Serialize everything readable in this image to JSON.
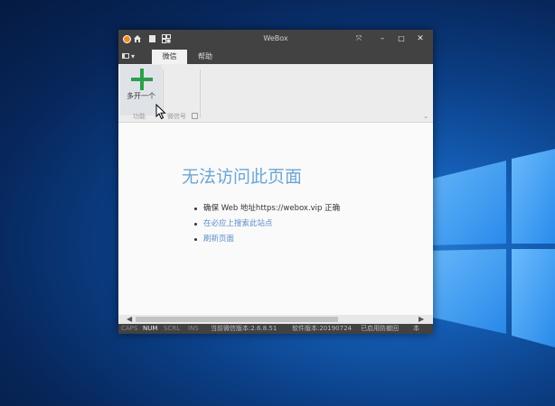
{
  "window": {
    "title": "WeBox",
    "controls": {
      "fullscreen": "⤧",
      "minimize": "–",
      "maximize": "□",
      "close": "✕"
    }
  },
  "tabs": {
    "menu": "▾",
    "items": [
      {
        "label": "微信",
        "active": true
      },
      {
        "label": "帮助",
        "active": false
      }
    ]
  },
  "ribbon": {
    "open_one_label": "多开一个",
    "group_function": "功能",
    "group_wechat": "微信号"
  },
  "content": {
    "error_title": "无法访问此页面",
    "items": [
      {
        "text": "确保 Web 地址https://webox.vip 正确",
        "link": false
      },
      {
        "text": "在必应上搜索此站点",
        "link": true
      },
      {
        "text": "刷新页面",
        "link": true
      }
    ]
  },
  "scrollbar": {
    "left_arrow": "◀",
    "right_arrow": "▶"
  },
  "statusbar": {
    "caps": "CAPS",
    "num": "NUM",
    "scrl": "SCRL",
    "ins": "INS",
    "wechat_version": "当前微信版本:2.6.8.51",
    "software_version": "软件版本:20190724",
    "anti_recall": "已启用防撤回",
    "more": "本"
  },
  "colors": {
    "titlebar": "#424242",
    "accent_link": "#5b8fc8",
    "error_title": "#6aa6d6",
    "plus_icon": "#2e9e4a"
  }
}
